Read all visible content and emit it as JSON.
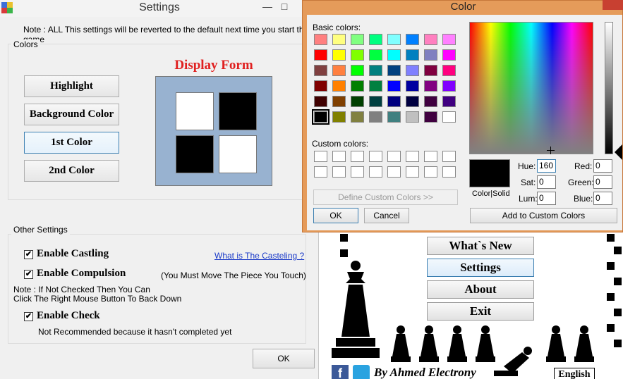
{
  "settings": {
    "title": "Settings",
    "note": "Note : ALL This settings will be reverted to the default next time you start the game",
    "colors_group": "Colors",
    "buttons": [
      "Highlight",
      "Background Color",
      "1st Color",
      "2nd Color"
    ],
    "display_form_title": "Display Form",
    "other_group": "Other Settings",
    "enable_castling": "Enable Castling",
    "castling_link": "What is The Casteling ?",
    "enable_compulsion": "Enable Compulsion",
    "compulsion_note": "(You Must Move The Piece You Touch)",
    "unchecked_note_1": "Note : If Not Checked Then You Can",
    "unchecked_note_2": "Click The Right Mouse Button To Back Down",
    "enable_check": "Enable Check",
    "check_note": "Not Recommended because it hasn't completed yet",
    "ok": "OK",
    "checkmark": "✔",
    "minimize": "—",
    "maximize": "□"
  },
  "color_dialog": {
    "title": "Color",
    "basic_colors_label": "Basic colors:",
    "custom_colors_label": "Custom colors:",
    "define_custom": "Define Custom Colors >>",
    "ok": "OK",
    "cancel": "Cancel",
    "color_solid": "Color|Solid",
    "hue_label": "Hue:",
    "hue": "160",
    "sat_label": "Sat:",
    "sat": "0",
    "lum_label": "Lum:",
    "lum": "0",
    "red_label": "Red:",
    "red": "0",
    "green_label": "Green:",
    "green": "0",
    "blue_label": "Blue:",
    "blue": "0",
    "add_custom": "Add to Custom Colors",
    "basic_colors": [
      "#ff8080",
      "#ffff80",
      "#80ff80",
      "#00ff80",
      "#80ffff",
      "#0080ff",
      "#ff80c0",
      "#ff80ff",
      "#ff0000",
      "#ffff00",
      "#80ff00",
      "#00ff40",
      "#00ffff",
      "#0080c0",
      "#8080c0",
      "#ff00ff",
      "#804040",
      "#ff8040",
      "#00ff00",
      "#008080",
      "#004080",
      "#8080ff",
      "#800040",
      "#ff0080",
      "#800000",
      "#ff8000",
      "#008000",
      "#008040",
      "#0000ff",
      "#0000a0",
      "#800080",
      "#8000ff",
      "#400000",
      "#804000",
      "#004000",
      "#004040",
      "#000080",
      "#000040",
      "#400040",
      "#400080",
      "#000000",
      "#808000",
      "#808040",
      "#808080",
      "#408080",
      "#c0c0c0",
      "#400040",
      "#ffffff"
    ]
  },
  "chess_app": {
    "menu": [
      "What`s New",
      "Settings",
      "About",
      "Exit"
    ],
    "author": "By Ahmed Electrony",
    "language": "English"
  }
}
